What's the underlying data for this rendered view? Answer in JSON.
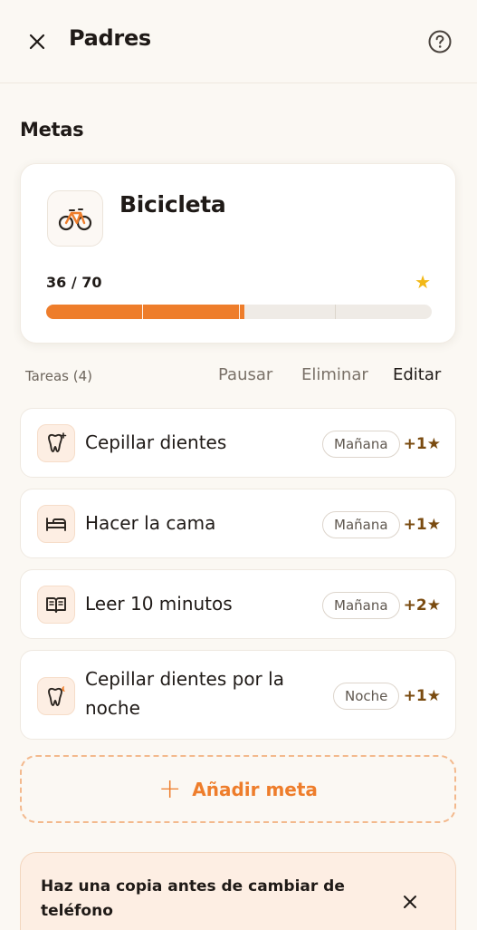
{
  "header": {
    "title": "Padres",
    "close_icon": "close-icon",
    "help_icon": "help-circle-icon"
  },
  "goals_section": {
    "title": "Metas"
  },
  "goal": {
    "name": "Bicicleta",
    "icon": "bicycle-icon",
    "progress_text": "36 / 70",
    "progress_current": 36,
    "progress_total": 70,
    "star_icon": "star-icon",
    "accent_color": "#ee7d2b",
    "star_color": "#f2b817"
  },
  "actions": {
    "tasks_count": "Tareas (4)",
    "pause": "Pausar",
    "delete": "Eliminar",
    "edit": "Editar"
  },
  "tasks": [
    {
      "name": "Cepillar dientes",
      "time": "Mañana",
      "points": "+1★",
      "icon": "tooth-sparkle-icon"
    },
    {
      "name": "Hacer la cama",
      "time": "Mañana",
      "points": "+1★",
      "icon": "bed-icon"
    },
    {
      "name": "Leer 10 minutos",
      "time": "Mañana",
      "points": "+2★",
      "icon": "book-icon"
    },
    {
      "name": "Cepillar dientes por la noche",
      "time": "Noche",
      "points": "+1★",
      "icon": "tooth-moon-icon"
    }
  ],
  "add_goal": {
    "label": "Añadir meta",
    "icon": "plus-icon"
  },
  "backup_banner": {
    "text": "Haz una copia antes de cambiar de teléfono",
    "close_icon": "close-icon"
  }
}
